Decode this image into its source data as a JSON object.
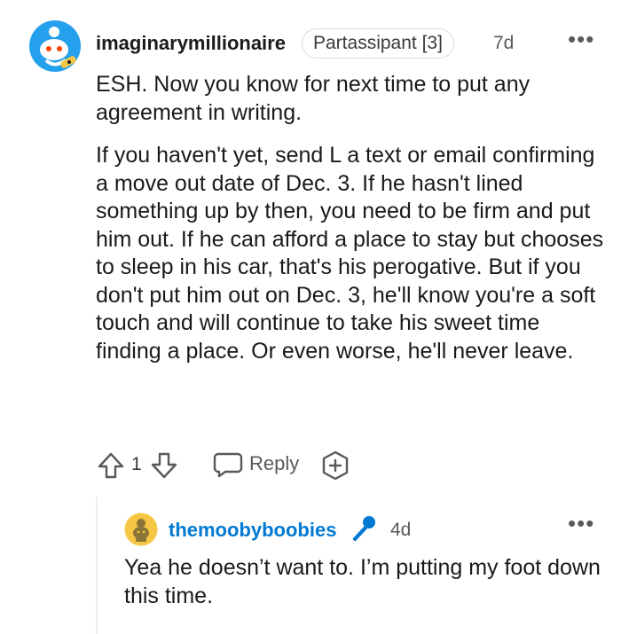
{
  "comment": {
    "username": "imaginarymillionaire",
    "flair": "Partassipant [3]",
    "time": "7d",
    "more_label": "•••",
    "paragraphs": [
      "ESH. Now you know for next time to put any agreement in writing.",
      "If you haven't yet, send L a text or email confirming a move out date of Dec. 3. If he hasn't lined something up by then, you need to be firm and put him out. If he can afford a place to stay but chooses to sleep in his car, that's his perogative. But if you don't put him out on Dec. 3, he'll know you're a soft touch and will continue to take his sweet time finding a place. Or even worse, he'll never leave."
    ],
    "score": "1",
    "reply_label": "Reply",
    "icons": {
      "upvote": "upvote-arrow-icon",
      "downvote": "downvote-arrow-icon",
      "reply": "speech-bubble-icon",
      "award": "award-plus-icon"
    }
  },
  "reply": {
    "username": "themoobyboobies",
    "time": "4d",
    "more_label": "•••",
    "text": "Yea he doesn’t want to. I’m putting my foot down this time.",
    "icons": {
      "badge": "microphone-icon"
    }
  },
  "colors": {
    "username_link": "#0079d3",
    "text": "#1a1a1b",
    "muted": "#57595b",
    "border": "#d7dadc"
  }
}
